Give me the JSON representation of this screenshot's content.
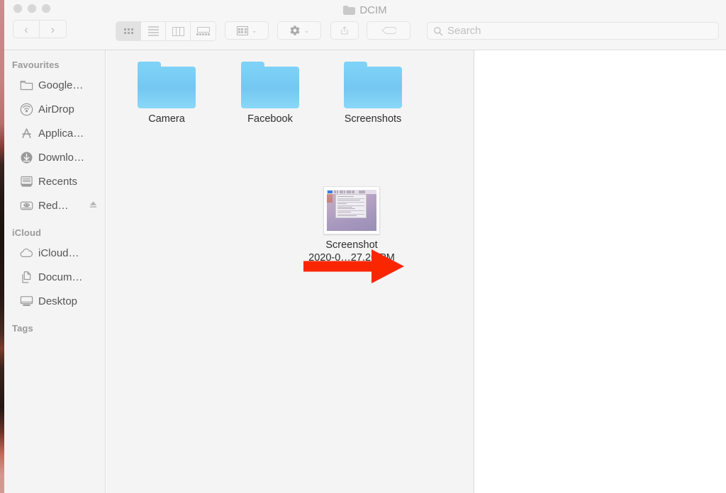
{
  "window": {
    "title": "DCIM",
    "title_icon": "folder-icon",
    "traffic_lights": [
      "close-button",
      "minimize-button",
      "zoom-button"
    ],
    "nav": {
      "back_label": "‹",
      "forward_label": "›"
    }
  },
  "toolbar": {
    "view_modes": [
      {
        "name": "icon-view",
        "icon": "grid-icon",
        "active": true
      },
      {
        "name": "list-view",
        "icon": "list-icon",
        "active": false
      },
      {
        "name": "column-view",
        "icon": "columns-icon",
        "active": false
      },
      {
        "name": "gallery-view",
        "icon": "gallery-icon",
        "active": false
      }
    ],
    "group_button": {
      "icon": "group-icon",
      "chevron": "⌄"
    },
    "action_button": {
      "icon": "gear-icon",
      "chevron": "⌄"
    },
    "share_button": {
      "icon": "share-icon"
    },
    "tags_button": {
      "icon": "tag-icon"
    }
  },
  "search": {
    "placeholder": "Search",
    "icon": "search-icon",
    "value": ""
  },
  "sidebar": {
    "sections": [
      {
        "header": "Favourites",
        "items": [
          {
            "label": "Google…",
            "icon": "folder-icon",
            "eject": false
          },
          {
            "label": "AirDrop",
            "icon": "airdrop-icon",
            "eject": false
          },
          {
            "label": "Applica…",
            "icon": "applications-icon",
            "eject": false
          },
          {
            "label": "Downlo…",
            "icon": "downloads-icon",
            "eject": false
          },
          {
            "label": "Recents",
            "icon": "recents-icon",
            "eject": false
          },
          {
            "label": "Red…",
            "icon": "external-drive-icon",
            "eject": true,
            "eject_icon": "eject-icon"
          }
        ]
      },
      {
        "header": "iCloud",
        "items": [
          {
            "label": "iCloud…",
            "icon": "cloud-icon",
            "eject": false
          },
          {
            "label": "Docum…",
            "icon": "documents-icon",
            "eject": false
          },
          {
            "label": "Desktop",
            "icon": "desktop-icon",
            "eject": false
          }
        ]
      },
      {
        "header": "Tags",
        "items": []
      }
    ]
  },
  "content": {
    "files": [
      {
        "name": "Camera",
        "type": "folder",
        "icon": "blue-folder-icon"
      },
      {
        "name": "Facebook",
        "type": "folder",
        "icon": "blue-folder-icon"
      },
      {
        "name": "Screenshots",
        "type": "folder",
        "icon": "blue-folder-icon"
      }
    ],
    "screenshot_file": {
      "line1": "Screenshot",
      "line2": "2020-0…27.26 PM",
      "type": "image",
      "icon": "screenshot-thumbnail"
    }
  },
  "annotation": {
    "arrow": {
      "name": "red-arrow-annotation",
      "color": "#FA2600",
      "direction": "right"
    }
  },
  "colors": {
    "folder_blue": "#7ED2F7",
    "arrow_red": "#FA2600",
    "sidebar_bg": "#F4F4F4",
    "toolbar_bg": "#F6F6F6",
    "label_text": "#2D2D2D"
  }
}
